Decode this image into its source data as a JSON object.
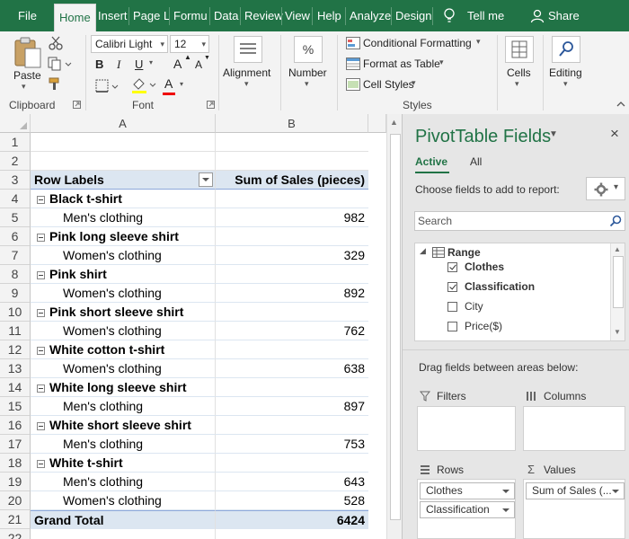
{
  "tabs": [
    {
      "label": "File"
    },
    {
      "label": "Home"
    },
    {
      "label": "Insert"
    },
    {
      "label": "Page L"
    },
    {
      "label": "Formu"
    },
    {
      "label": "Data"
    },
    {
      "label": "Review"
    },
    {
      "label": "View"
    },
    {
      "label": "Help"
    },
    {
      "label": "Analyze"
    },
    {
      "label": "Design"
    }
  ],
  "tell_me": "Tell me",
  "share": "Share",
  "ribbon": {
    "paste": "Paste",
    "clipboard": "Clipboard",
    "font_name": "Calibri Light",
    "font_size": "12",
    "font_group": "Font",
    "bold": "B",
    "italic": "I",
    "underline": "U",
    "alignment": "Alignment",
    "number": "Number",
    "conditional_formatting": "Conditional Formatting",
    "format_as_table": "Format as Table",
    "cell_styles": "Cell Styles",
    "styles": "Styles",
    "cells": "Cells",
    "editing": "Editing",
    "percent": "%",
    "grow_font": "A",
    "shrink_font": "A",
    "font_color": "A"
  },
  "sheet": {
    "col_a": "A",
    "col_b": "B",
    "rows": [
      {
        "n": "1",
        "kind": "blank",
        "a": "",
        "b": ""
      },
      {
        "n": "2",
        "kind": "blank",
        "a": "",
        "b": ""
      },
      {
        "n": "3",
        "kind": "hdr",
        "a": "Row Labels",
        "b": "Sum of Sales (pieces)"
      },
      {
        "n": "4",
        "kind": "l1",
        "a": "Black t-shirt",
        "b": ""
      },
      {
        "n": "5",
        "kind": "l2",
        "a": "Men's clothing",
        "b": "982"
      },
      {
        "n": "6",
        "kind": "l1",
        "a": "Pink long sleeve shirt",
        "b": ""
      },
      {
        "n": "7",
        "kind": "l2",
        "a": "Women's clothing",
        "b": "329"
      },
      {
        "n": "8",
        "kind": "l1",
        "a": "Pink shirt",
        "b": ""
      },
      {
        "n": "9",
        "kind": "l2",
        "a": "Women's clothing",
        "b": "892"
      },
      {
        "n": "10",
        "kind": "l1",
        "a": "Pink short sleeve shirt",
        "b": ""
      },
      {
        "n": "11",
        "kind": "l2",
        "a": "Women's clothing",
        "b": "762"
      },
      {
        "n": "12",
        "kind": "l1",
        "a": "White cotton t-shirt",
        "b": ""
      },
      {
        "n": "13",
        "kind": "l2",
        "a": "Women's clothing",
        "b": "638"
      },
      {
        "n": "14",
        "kind": "l1",
        "a": "White long sleeve shirt",
        "b": ""
      },
      {
        "n": "15",
        "kind": "l2",
        "a": "Men's clothing",
        "b": "897"
      },
      {
        "n": "16",
        "kind": "l1",
        "a": "White short sleeve shirt",
        "b": ""
      },
      {
        "n": "17",
        "kind": "l2",
        "a": "Men's clothing",
        "b": "753"
      },
      {
        "n": "18",
        "kind": "l1",
        "a": "White t-shirt",
        "b": ""
      },
      {
        "n": "19",
        "kind": "l2",
        "a": "Men's clothing",
        "b": "643"
      },
      {
        "n": "20",
        "kind": "l2",
        "a": "Women's clothing",
        "b": "528"
      },
      {
        "n": "21",
        "kind": "total",
        "a": "Grand Total",
        "b": "6424"
      },
      {
        "n": "22",
        "kind": "blank",
        "a": "",
        "b": ""
      }
    ]
  },
  "pivot": {
    "title": "PivotTable Fields",
    "tab_active": "Active",
    "tab_all": "All",
    "choose_fields": "Choose fields to add to report:",
    "search_placeholder": "Search",
    "range": "Range",
    "fields": [
      {
        "label": "Clothes",
        "checked": true
      },
      {
        "label": "Classification",
        "checked": true
      },
      {
        "label": "City",
        "checked": false
      },
      {
        "label": "Price($)",
        "checked": false
      }
    ],
    "drag_hint": "Drag fields between areas below:",
    "filters": "Filters",
    "columns": "Columns",
    "rows": "Rows",
    "values": "Values",
    "row_pills": [
      "Clothes",
      "Classification"
    ],
    "value_pill": "Sum of Sales (..."
  }
}
